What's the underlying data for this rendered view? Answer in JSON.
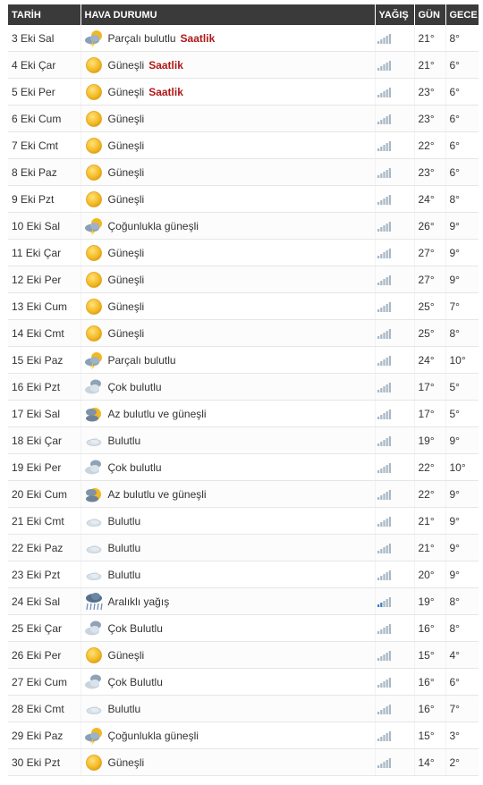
{
  "colors": {
    "header_bg": "#3a3a3a",
    "header_text": "#ffffff",
    "saatlik_link": "#b01818",
    "bar_gray": "#a9b8c6",
    "bar_blue": "#3d7ec6",
    "sun": "#f2b821"
  },
  "header": {
    "date": "TARİH",
    "weather": "HAVA DURUMU",
    "rain": "YAĞIŞ",
    "day": "GÜN",
    "night": "GECE"
  },
  "rows": [
    {
      "date": "3 Eki Sal",
      "icon": "partly-cloudy-storm-icon",
      "desc": "Parçalı bulutlu",
      "saatlik": "Saatlik",
      "day": "21°",
      "night": "8°",
      "rain": "low"
    },
    {
      "date": "4 Eki Çar",
      "icon": "sunny-icon",
      "desc": "Güneşli",
      "saatlik": "Saatlik",
      "day": "21°",
      "night": "6°",
      "rain": "low"
    },
    {
      "date": "5 Eki Per",
      "icon": "sunny-icon",
      "desc": "Güneşli",
      "saatlik": "Saatlik",
      "day": "23°",
      "night": "6°",
      "rain": "low"
    },
    {
      "date": "6 Eki Cum",
      "icon": "sunny-icon",
      "desc": "Güneşli",
      "saatlik": "",
      "day": "23°",
      "night": "6°",
      "rain": "low"
    },
    {
      "date": "7 Eki Cmt",
      "icon": "sunny-icon",
      "desc": "Güneşli",
      "saatlik": "",
      "day": "22°",
      "night": "6°",
      "rain": "low"
    },
    {
      "date": "8 Eki Paz",
      "icon": "sunny-icon",
      "desc": "Güneşli",
      "saatlik": "",
      "day": "23°",
      "night": "6°",
      "rain": "low"
    },
    {
      "date": "9 Eki Pzt",
      "icon": "sunny-icon",
      "desc": "Güneşli",
      "saatlik": "",
      "day": "24°",
      "night": "8°",
      "rain": "low"
    },
    {
      "date": "10 Eki Sal",
      "icon": "partly-cloudy-storm-icon",
      "desc": "Çoğunlukla güneşli",
      "saatlik": "",
      "day": "26°",
      "night": "9°",
      "rain": "low"
    },
    {
      "date": "11 Eki Çar",
      "icon": "sunny-icon",
      "desc": "Güneşli",
      "saatlik": "",
      "day": "27°",
      "night": "9°",
      "rain": "low"
    },
    {
      "date": "12 Eki Per",
      "icon": "sunny-icon",
      "desc": "Güneşli",
      "saatlik": "",
      "day": "27°",
      "night": "9°",
      "rain": "low"
    },
    {
      "date": "13 Eki Cum",
      "icon": "sunny-icon",
      "desc": "Güneşli",
      "saatlik": "",
      "day": "25°",
      "night": "7°",
      "rain": "low"
    },
    {
      "date": "14 Eki Cmt",
      "icon": "sunny-icon",
      "desc": "Güneşli",
      "saatlik": "",
      "day": "25°",
      "night": "8°",
      "rain": "low"
    },
    {
      "date": "15 Eki Paz",
      "icon": "partly-cloudy-storm-icon",
      "desc": "Parçalı bulutlu",
      "saatlik": "",
      "day": "24°",
      "night": "10°",
      "rain": "low"
    },
    {
      "date": "16 Eki Pzt",
      "icon": "mostly-cloudy-icon",
      "desc": "Çok bulutlu",
      "saatlik": "",
      "day": "17°",
      "night": "5°",
      "rain": "low"
    },
    {
      "date": "17 Eki Sal",
      "icon": "cloud-sun-icon",
      "desc": "Az bulutlu ve güneşli",
      "saatlik": "",
      "day": "17°",
      "night": "5°",
      "rain": "low"
    },
    {
      "date": "18 Eki Çar",
      "icon": "cloud-icon",
      "desc": "Bulutlu",
      "saatlik": "",
      "day": "19°",
      "night": "9°",
      "rain": "low"
    },
    {
      "date": "19 Eki Per",
      "icon": "mostly-cloudy-icon",
      "desc": "Çok bulutlu",
      "saatlik": "",
      "day": "22°",
      "night": "10°",
      "rain": "low"
    },
    {
      "date": "20 Eki Cum",
      "icon": "cloud-sun-icon",
      "desc": "Az bulutlu ve güneşli",
      "saatlik": "",
      "day": "22°",
      "night": "9°",
      "rain": "low"
    },
    {
      "date": "21 Eki Cmt",
      "icon": "cloud-icon",
      "desc": "Bulutlu",
      "saatlik": "",
      "day": "21°",
      "night": "9°",
      "rain": "low"
    },
    {
      "date": "22 Eki Paz",
      "icon": "cloud-icon",
      "desc": "Bulutlu",
      "saatlik": "",
      "day": "21°",
      "night": "9°",
      "rain": "low"
    },
    {
      "date": "23 Eki Pzt",
      "icon": "cloud-icon",
      "desc": "Bulutlu",
      "saatlik": "",
      "day": "20°",
      "night": "9°",
      "rain": "low"
    },
    {
      "date": "24 Eki Sal",
      "icon": "rain-icon",
      "desc": "Aralıklı yağış",
      "saatlik": "",
      "day": "19°",
      "night": "8°",
      "rain": "medium"
    },
    {
      "date": "25 Eki Çar",
      "icon": "mostly-cloudy-icon",
      "desc": "Çok Bulutlu",
      "saatlik": "",
      "day": "16°",
      "night": "8°",
      "rain": "low"
    },
    {
      "date": "26 Eki Per",
      "icon": "sunny-icon",
      "desc": "Güneşli",
      "saatlik": "",
      "day": "15°",
      "night": "4°",
      "rain": "low"
    },
    {
      "date": "27 Eki Cum",
      "icon": "mostly-cloudy-icon",
      "desc": "Çok Bulutlu",
      "saatlik": "",
      "day": "16°",
      "night": "6°",
      "rain": "low"
    },
    {
      "date": "28 Eki Cmt",
      "icon": "cloud-icon",
      "desc": "Bulutlu",
      "saatlik": "",
      "day": "16°",
      "night": "7°",
      "rain": "low"
    },
    {
      "date": "29 Eki Paz",
      "icon": "partly-cloudy-storm-icon",
      "desc": "Çoğunlukla güneşli",
      "saatlik": "",
      "day": "15°",
      "night": "3°",
      "rain": "low"
    },
    {
      "date": "30 Eki Pzt",
      "icon": "sunny-icon",
      "desc": "Güneşli",
      "saatlik": "",
      "day": "14°",
      "night": "2°",
      "rain": "low"
    }
  ]
}
